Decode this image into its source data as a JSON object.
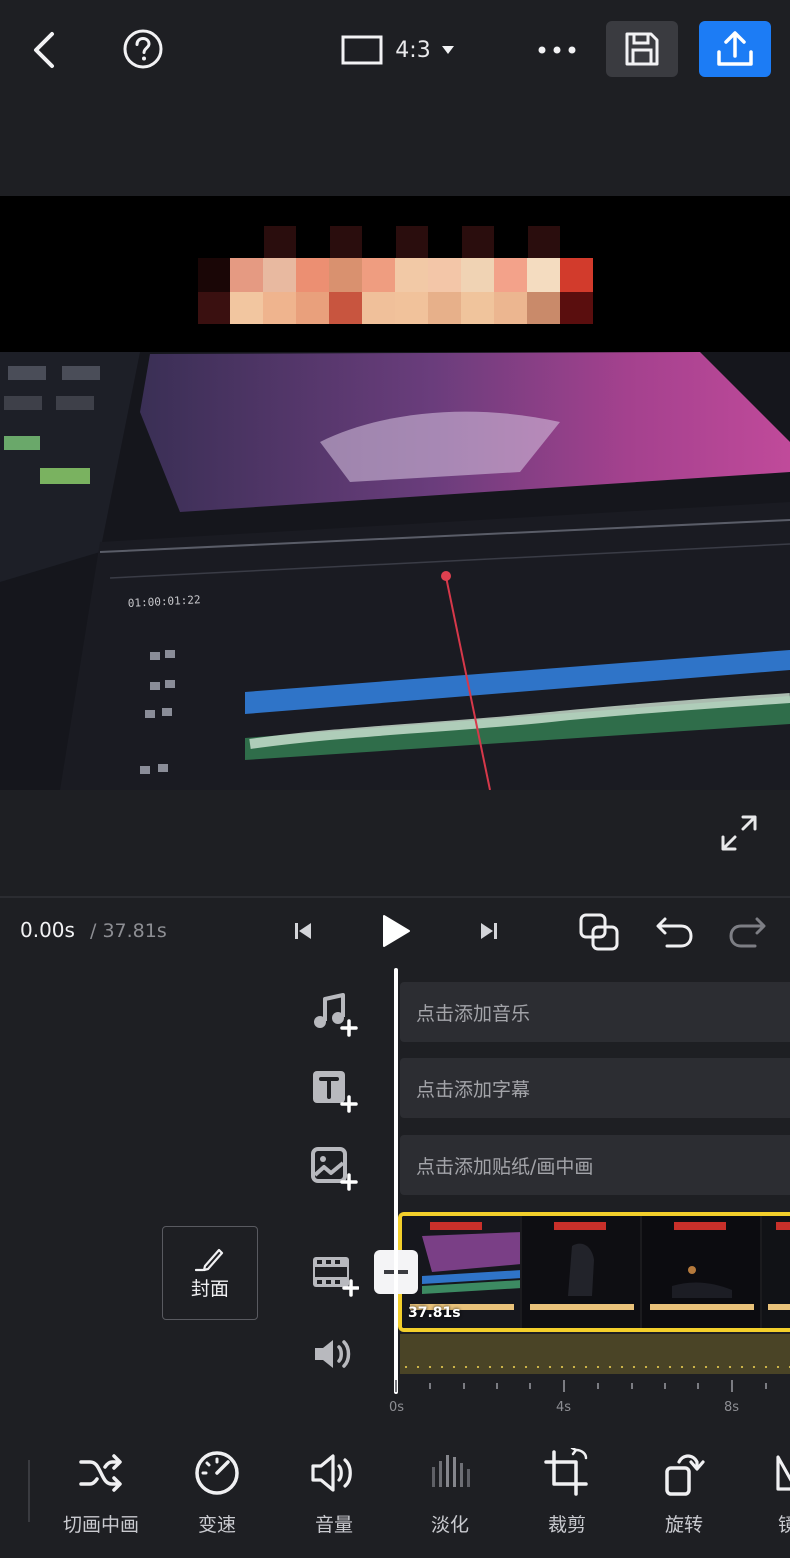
{
  "header": {
    "aspect_ratio": "4:3"
  },
  "player": {
    "current_time": "0.00s",
    "total_time": "/ 37.81s"
  },
  "tracks": {
    "music_placeholder": "点击添加音乐",
    "subtitle_placeholder": "点击添加字幕",
    "sticker_placeholder": "点击添加贴纸/画中画"
  },
  "cover": {
    "label": "封面"
  },
  "clip": {
    "duration": "37.81s"
  },
  "ruler": {
    "labels": [
      "0s",
      "4s",
      "8s"
    ]
  },
  "toolbar": {
    "items": [
      {
        "label": "切画中画",
        "icon": "shuffle-icon"
      },
      {
        "label": "变速",
        "icon": "speedometer-icon"
      },
      {
        "label": "音量",
        "icon": "volume-icon"
      },
      {
        "label": "淡化",
        "icon": "fade-bars-icon"
      },
      {
        "label": "裁剪",
        "icon": "crop-icon"
      },
      {
        "label": "旋转",
        "icon": "rotate-icon"
      },
      {
        "label": "镜",
        "icon": "mirror-icon"
      }
    ]
  },
  "colors": {
    "accent": "#1c7cf5",
    "clip_border": "#f3cf2b",
    "background": "#1e1f23"
  }
}
